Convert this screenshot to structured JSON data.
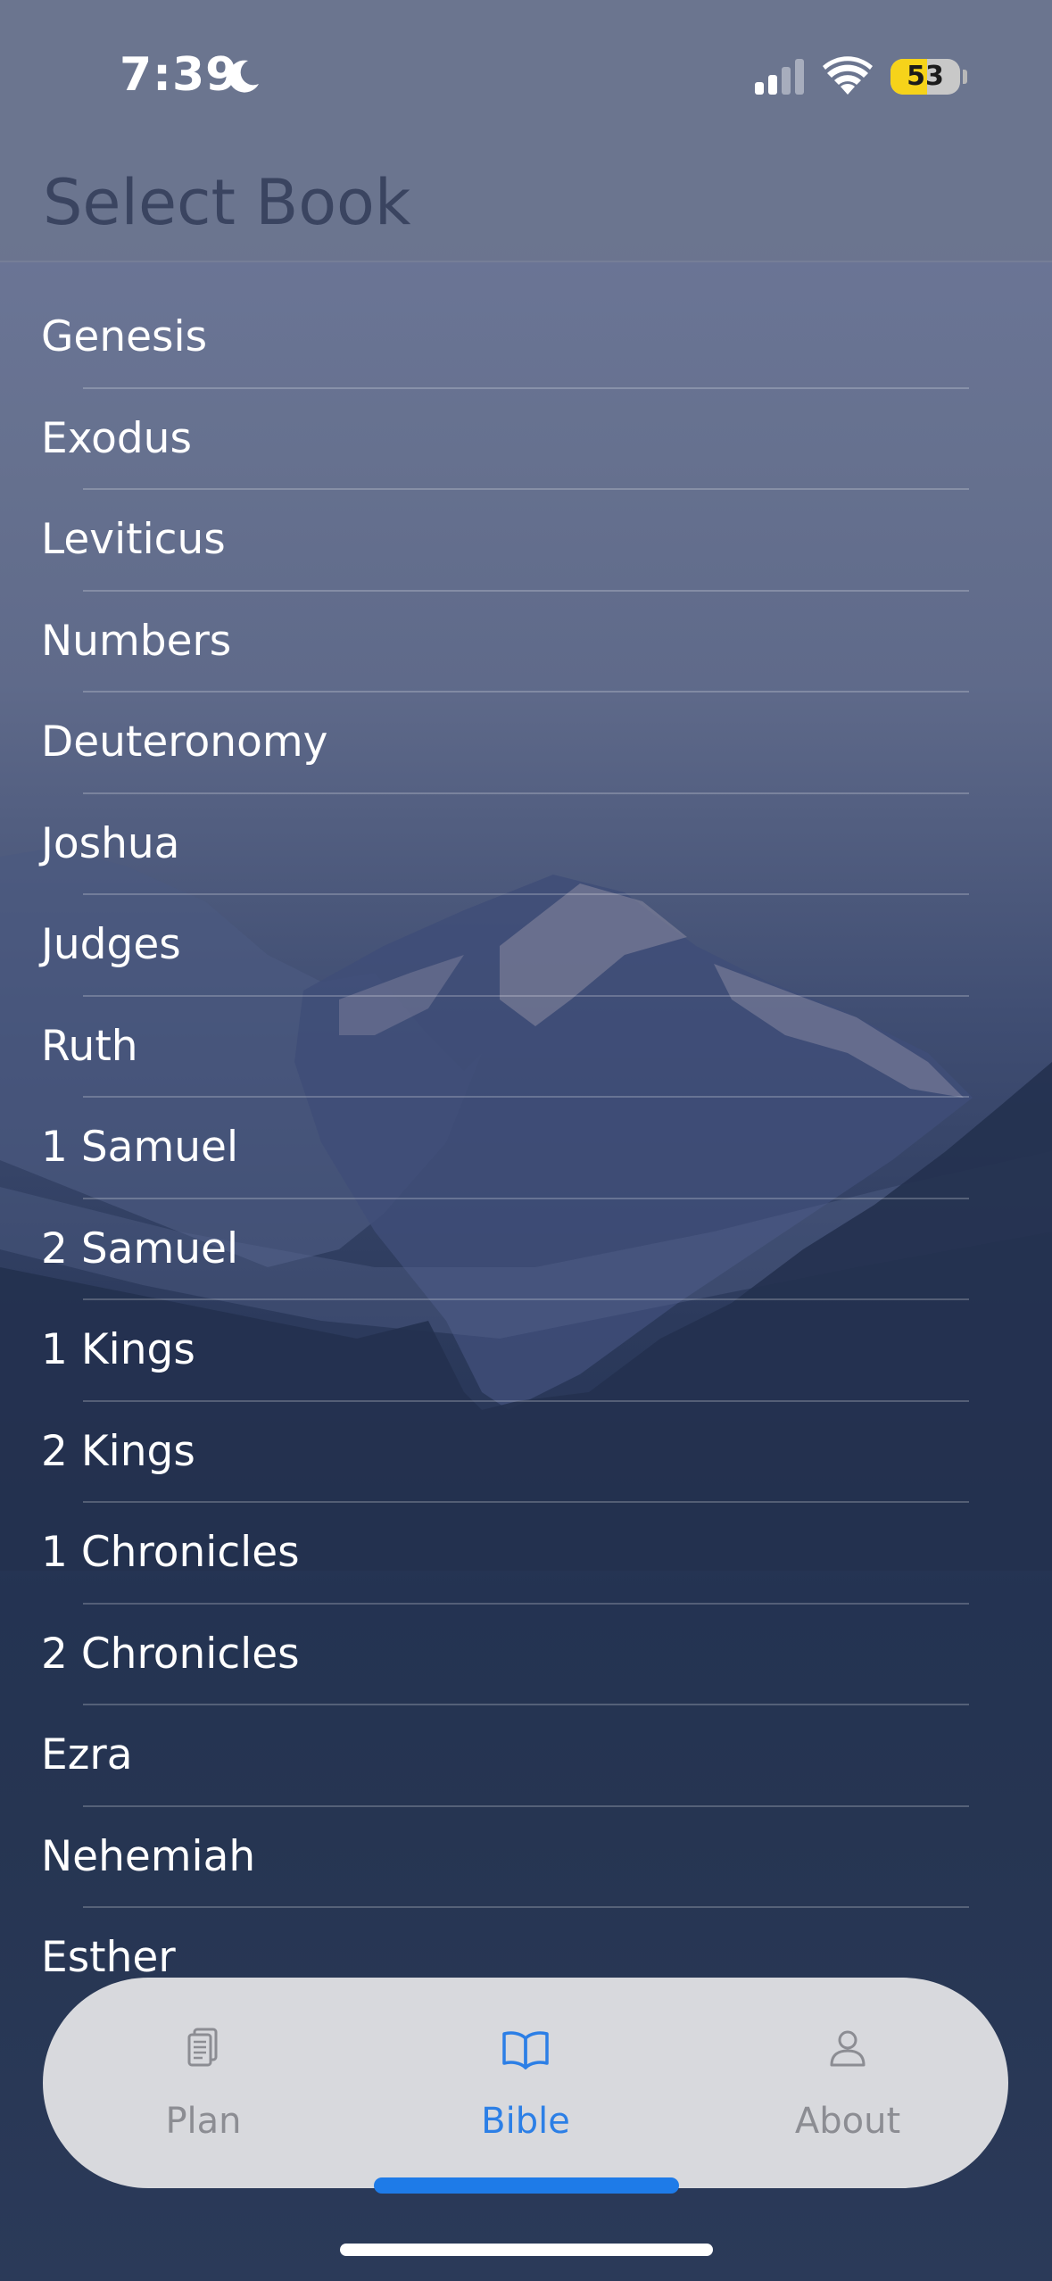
{
  "status_bar": {
    "time": "7:39",
    "battery_level": "53",
    "icons": [
      "moon-icon",
      "cellular-signal-icon",
      "wifi-icon",
      "battery-icon"
    ]
  },
  "header": {
    "title": "Select Book"
  },
  "books": [
    {
      "label": "Genesis"
    },
    {
      "label": "Exodus"
    },
    {
      "label": "Leviticus"
    },
    {
      "label": "Numbers"
    },
    {
      "label": "Deuteronomy"
    },
    {
      "label": "Joshua"
    },
    {
      "label": "Judges"
    },
    {
      "label": "Ruth"
    },
    {
      "label": "1 Samuel"
    },
    {
      "label": "2 Samuel"
    },
    {
      "label": "1 Kings"
    },
    {
      "label": "2 Kings"
    },
    {
      "label": "1 Chronicles"
    },
    {
      "label": "2 Chronicles"
    },
    {
      "label": "Ezra"
    },
    {
      "label": "Nehemiah"
    },
    {
      "label": "Esther"
    }
  ],
  "tab_bar": {
    "selected": "Bible",
    "tabs": [
      {
        "label": "Plan",
        "icon": "document-icon"
      },
      {
        "label": "Bible",
        "icon": "open-book-icon"
      },
      {
        "label": "About",
        "icon": "person-icon"
      }
    ]
  },
  "colors": {
    "accent": "#2c7fe6",
    "tab_bar_background": "#d8d9dd",
    "inactive_tab": "#8c8d93",
    "battery_fill": "#f6d31a"
  }
}
